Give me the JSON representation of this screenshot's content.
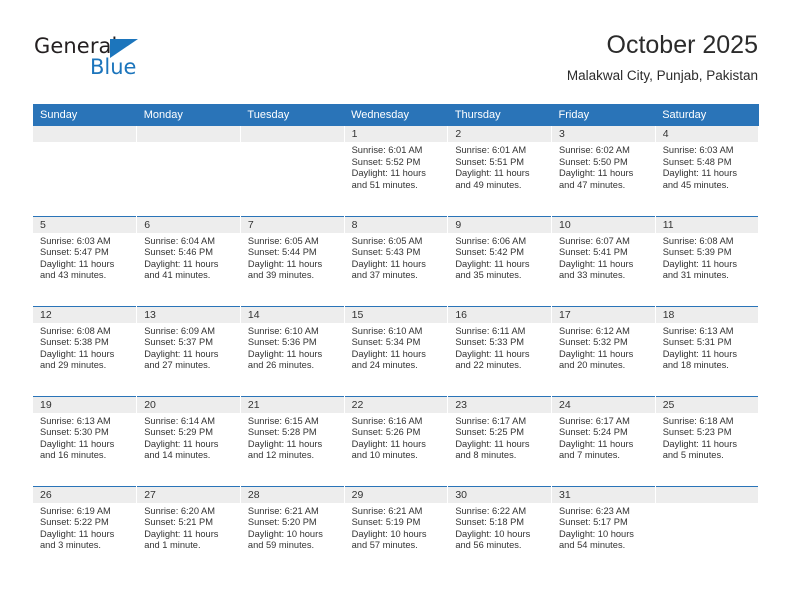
{
  "brand": {
    "name_top": "General",
    "name_bottom": "Blue",
    "triangle_icon": "triangle-icon",
    "accent_color": "#1c75bc"
  },
  "header": {
    "title": "October 2025",
    "subtitle": "Malakwal City, Punjab, Pakistan"
  },
  "theme": {
    "header_blue": "#2a74b8",
    "daynum_band": "#ededed",
    "text": "#333333"
  },
  "weekday_headers": [
    "Sunday",
    "Monday",
    "Tuesday",
    "Wednesday",
    "Thursday",
    "Friday",
    "Saturday"
  ],
  "weeks": [
    [
      {
        "day": "",
        "sunrise": "",
        "sunset": "",
        "daylight_line1": "",
        "daylight_line2": "",
        "empty": true
      },
      {
        "day": "",
        "sunrise": "",
        "sunset": "",
        "daylight_line1": "",
        "daylight_line2": "",
        "empty": true
      },
      {
        "day": "",
        "sunrise": "",
        "sunset": "",
        "daylight_line1": "",
        "daylight_line2": "",
        "empty": true
      },
      {
        "day": "1",
        "sunrise": "Sunrise: 6:01 AM",
        "sunset": "Sunset: 5:52 PM",
        "daylight_line1": "Daylight: 11 hours",
        "daylight_line2": "and 51 minutes."
      },
      {
        "day": "2",
        "sunrise": "Sunrise: 6:01 AM",
        "sunset": "Sunset: 5:51 PM",
        "daylight_line1": "Daylight: 11 hours",
        "daylight_line2": "and 49 minutes."
      },
      {
        "day": "3",
        "sunrise": "Sunrise: 6:02 AM",
        "sunset": "Sunset: 5:50 PM",
        "daylight_line1": "Daylight: 11 hours",
        "daylight_line2": "and 47 minutes."
      },
      {
        "day": "4",
        "sunrise": "Sunrise: 6:03 AM",
        "sunset": "Sunset: 5:48 PM",
        "daylight_line1": "Daylight: 11 hours",
        "daylight_line2": "and 45 minutes."
      }
    ],
    [
      {
        "day": "5",
        "sunrise": "Sunrise: 6:03 AM",
        "sunset": "Sunset: 5:47 PM",
        "daylight_line1": "Daylight: 11 hours",
        "daylight_line2": "and 43 minutes."
      },
      {
        "day": "6",
        "sunrise": "Sunrise: 6:04 AM",
        "sunset": "Sunset: 5:46 PM",
        "daylight_line1": "Daylight: 11 hours",
        "daylight_line2": "and 41 minutes."
      },
      {
        "day": "7",
        "sunrise": "Sunrise: 6:05 AM",
        "sunset": "Sunset: 5:44 PM",
        "daylight_line1": "Daylight: 11 hours",
        "daylight_line2": "and 39 minutes."
      },
      {
        "day": "8",
        "sunrise": "Sunrise: 6:05 AM",
        "sunset": "Sunset: 5:43 PM",
        "daylight_line1": "Daylight: 11 hours",
        "daylight_line2": "and 37 minutes."
      },
      {
        "day": "9",
        "sunrise": "Sunrise: 6:06 AM",
        "sunset": "Sunset: 5:42 PM",
        "daylight_line1": "Daylight: 11 hours",
        "daylight_line2": "and 35 minutes."
      },
      {
        "day": "10",
        "sunrise": "Sunrise: 6:07 AM",
        "sunset": "Sunset: 5:41 PM",
        "daylight_line1": "Daylight: 11 hours",
        "daylight_line2": "and 33 minutes."
      },
      {
        "day": "11",
        "sunrise": "Sunrise: 6:08 AM",
        "sunset": "Sunset: 5:39 PM",
        "daylight_line1": "Daylight: 11 hours",
        "daylight_line2": "and 31 minutes."
      }
    ],
    [
      {
        "day": "12",
        "sunrise": "Sunrise: 6:08 AM",
        "sunset": "Sunset: 5:38 PM",
        "daylight_line1": "Daylight: 11 hours",
        "daylight_line2": "and 29 minutes."
      },
      {
        "day": "13",
        "sunrise": "Sunrise: 6:09 AM",
        "sunset": "Sunset: 5:37 PM",
        "daylight_line1": "Daylight: 11 hours",
        "daylight_line2": "and 27 minutes."
      },
      {
        "day": "14",
        "sunrise": "Sunrise: 6:10 AM",
        "sunset": "Sunset: 5:36 PM",
        "daylight_line1": "Daylight: 11 hours",
        "daylight_line2": "and 26 minutes."
      },
      {
        "day": "15",
        "sunrise": "Sunrise: 6:10 AM",
        "sunset": "Sunset: 5:34 PM",
        "daylight_line1": "Daylight: 11 hours",
        "daylight_line2": "and 24 minutes."
      },
      {
        "day": "16",
        "sunrise": "Sunrise: 6:11 AM",
        "sunset": "Sunset: 5:33 PM",
        "daylight_line1": "Daylight: 11 hours",
        "daylight_line2": "and 22 minutes."
      },
      {
        "day": "17",
        "sunrise": "Sunrise: 6:12 AM",
        "sunset": "Sunset: 5:32 PM",
        "daylight_line1": "Daylight: 11 hours",
        "daylight_line2": "and 20 minutes."
      },
      {
        "day": "18",
        "sunrise": "Sunrise: 6:13 AM",
        "sunset": "Sunset: 5:31 PM",
        "daylight_line1": "Daylight: 11 hours",
        "daylight_line2": "and 18 minutes."
      }
    ],
    [
      {
        "day": "19",
        "sunrise": "Sunrise: 6:13 AM",
        "sunset": "Sunset: 5:30 PM",
        "daylight_line1": "Daylight: 11 hours",
        "daylight_line2": "and 16 minutes."
      },
      {
        "day": "20",
        "sunrise": "Sunrise: 6:14 AM",
        "sunset": "Sunset: 5:29 PM",
        "daylight_line1": "Daylight: 11 hours",
        "daylight_line2": "and 14 minutes."
      },
      {
        "day": "21",
        "sunrise": "Sunrise: 6:15 AM",
        "sunset": "Sunset: 5:28 PM",
        "daylight_line1": "Daylight: 11 hours",
        "daylight_line2": "and 12 minutes."
      },
      {
        "day": "22",
        "sunrise": "Sunrise: 6:16 AM",
        "sunset": "Sunset: 5:26 PM",
        "daylight_line1": "Daylight: 11 hours",
        "daylight_line2": "and 10 minutes."
      },
      {
        "day": "23",
        "sunrise": "Sunrise: 6:17 AM",
        "sunset": "Sunset: 5:25 PM",
        "daylight_line1": "Daylight: 11 hours",
        "daylight_line2": "and 8 minutes."
      },
      {
        "day": "24",
        "sunrise": "Sunrise: 6:17 AM",
        "sunset": "Sunset: 5:24 PM",
        "daylight_line1": "Daylight: 11 hours",
        "daylight_line2": "and 7 minutes."
      },
      {
        "day": "25",
        "sunrise": "Sunrise: 6:18 AM",
        "sunset": "Sunset: 5:23 PM",
        "daylight_line1": "Daylight: 11 hours",
        "daylight_line2": "and 5 minutes."
      }
    ],
    [
      {
        "day": "26",
        "sunrise": "Sunrise: 6:19 AM",
        "sunset": "Sunset: 5:22 PM",
        "daylight_line1": "Daylight: 11 hours",
        "daylight_line2": "and 3 minutes."
      },
      {
        "day": "27",
        "sunrise": "Sunrise: 6:20 AM",
        "sunset": "Sunset: 5:21 PM",
        "daylight_line1": "Daylight: 11 hours",
        "daylight_line2": "and 1 minute."
      },
      {
        "day": "28",
        "sunrise": "Sunrise: 6:21 AM",
        "sunset": "Sunset: 5:20 PM",
        "daylight_line1": "Daylight: 10 hours",
        "daylight_line2": "and 59 minutes."
      },
      {
        "day": "29",
        "sunrise": "Sunrise: 6:21 AM",
        "sunset": "Sunset: 5:19 PM",
        "daylight_line1": "Daylight: 10 hours",
        "daylight_line2": "and 57 minutes."
      },
      {
        "day": "30",
        "sunrise": "Sunrise: 6:22 AM",
        "sunset": "Sunset: 5:18 PM",
        "daylight_line1": "Daylight: 10 hours",
        "daylight_line2": "and 56 minutes."
      },
      {
        "day": "31",
        "sunrise": "Sunrise: 6:23 AM",
        "sunset": "Sunset: 5:17 PM",
        "daylight_line1": "Daylight: 10 hours",
        "daylight_line2": "and 54 minutes."
      },
      {
        "day": "",
        "sunrise": "",
        "sunset": "",
        "daylight_line1": "",
        "daylight_line2": "",
        "empty": true
      }
    ]
  ]
}
